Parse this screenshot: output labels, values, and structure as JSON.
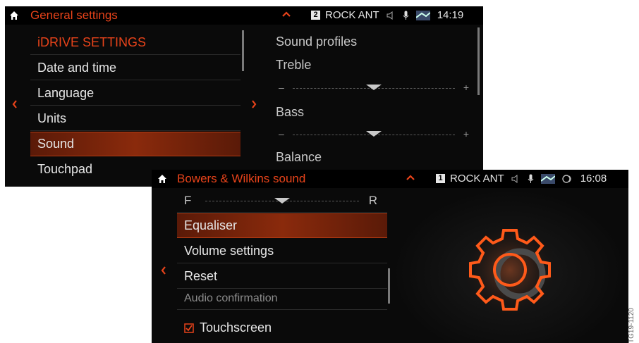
{
  "screen1": {
    "title": "General settings",
    "status": {
      "source_number": "2",
      "station": "ROCK ANT",
      "time": "14:19"
    },
    "menu": [
      {
        "label": "iDRIVE SETTINGS"
      },
      {
        "label": "Date and time"
      },
      {
        "label": "Language"
      },
      {
        "label": "Units"
      },
      {
        "label": "Sound"
      },
      {
        "label": "Touchpad"
      }
    ],
    "panel": {
      "heading": "Sound profiles",
      "treble_label": "Treble",
      "bass_label": "Bass",
      "balance_label": "Balance",
      "minus": "–",
      "plus": "+",
      "treble_level": 0.5,
      "bass_level": 0.5
    }
  },
  "screen2": {
    "title": "Bowers & Wilkins sound",
    "status": {
      "source_number": "1",
      "station": "ROCK ANT",
      "time": "16:08"
    },
    "fader": {
      "left": "F",
      "right": "R",
      "level": 0.5
    },
    "menu": [
      {
        "label": "Equaliser"
      },
      {
        "label": "Volume settings"
      },
      {
        "label": "Reset"
      },
      {
        "label": "Audio confirmation"
      },
      {
        "label": "Touchscreen",
        "checked": true
      }
    ]
  },
  "watermark": "TG19-1120",
  "colors": {
    "accent": "#e8431a",
    "background": "#0a0a0a",
    "text": "#e6e6e6"
  },
  "icons": [
    "home-icon",
    "chevron-left-icon",
    "chevron-right-icon",
    "chevron-up-icon",
    "speaker-icon",
    "microphone-icon",
    "navigation-icon",
    "connected-icon",
    "gear-icon",
    "checkbox-icon"
  ]
}
